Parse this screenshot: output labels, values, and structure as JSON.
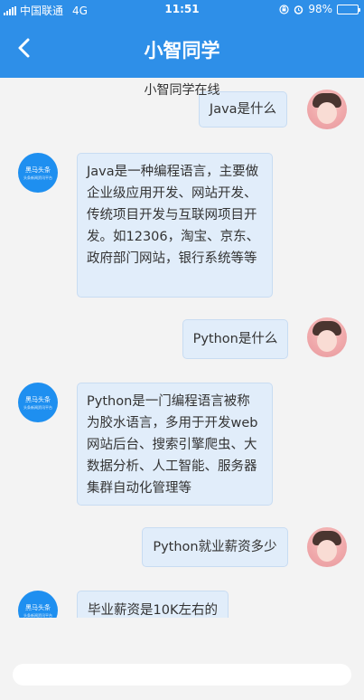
{
  "status_bar": {
    "carrier": "中国联通",
    "network": "4G",
    "time": "11:51",
    "battery": "98%",
    "battery_level": 0.98
  },
  "nav": {
    "back_icon": "chevron-left-icon",
    "title": "小智同学"
  },
  "chat": {
    "online_status": "小智同学在线",
    "bot_avatar": {
      "line1": "黑马头条",
      "line2": "头条新闻资讯平台"
    },
    "messages": [
      {
        "from": "user",
        "text": "Java是什么"
      },
      {
        "from": "bot",
        "text": "Java是一种编程语言，主要做企业级应用开发、网站开发、传统项目开发与互联网项目开发。如12306，淘宝、京东、政府部门网站，银行系统等等"
      },
      {
        "from": "user",
        "text": "Python是什么"
      },
      {
        "from": "bot",
        "text": "Python是一门编程语言被称为胶水语言，多用于开发web网站后台、搜索引擎爬虫、大数据分析、人工智能、服务器集群自动化管理等"
      },
      {
        "from": "user",
        "text": "Python就业薪资多少"
      },
      {
        "from": "bot",
        "text": "毕业薪资是10K左右的"
      }
    ]
  },
  "input": {
    "value": "",
    "placeholder": ""
  },
  "colors": {
    "brand_blue": "#2e8fe8",
    "bubble_bg": "#e1edfa",
    "bubble_border": "#c8dcf2",
    "chat_bg": "#f3f3f3"
  }
}
